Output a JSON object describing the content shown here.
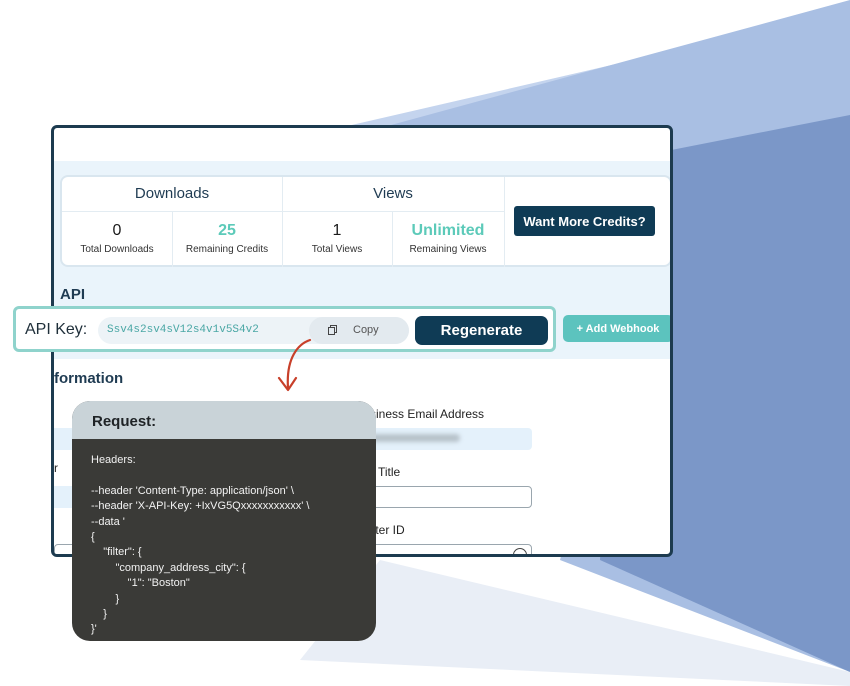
{
  "stats": {
    "downloads_header": "Downloads",
    "views_header": "Views",
    "total_downloads": {
      "value": "0",
      "label": "Total Downloads"
    },
    "remaining_credits": {
      "value": "25",
      "label": "Remaining Credits"
    },
    "total_views": {
      "value": "1",
      "label": "Total Views"
    },
    "remaining_views": {
      "value": "Unlimited",
      "label": "Remaining Views"
    },
    "more_credits_label": "Want More Credits?"
  },
  "api": {
    "section_title": "API",
    "key_label": "API Key:",
    "key_value": "Ssv4s2sv4sV12s4v1v5S4v2",
    "copy_label": "Copy",
    "regenerate_label": "Regenerate",
    "webhook_label": "+ Add Webhook"
  },
  "info": {
    "section_title": "formation",
    "business_email_label": "siness Email Address",
    "job_title_label": "Title",
    "twitter_label": "tter ID",
    "left_label": "r"
  },
  "request": {
    "title": "Request:",
    "code": "Headers:\n\n--header 'Content-Type: application/json' \\\n--header 'X-API-Key: +IxVG5Qxxxxxxxxxxx' \\\n--data '\n{\n    \"filter\": {\n        \"company_address_city\": {\n            \"1\": \"Boston\"\n        }\n    }\n}'"
  },
  "colors": {
    "navy": "#0f3b55",
    "teal": "#5ccab9",
    "band_blue": "#a9bfe3",
    "band_shadow": "#7b97c8"
  }
}
